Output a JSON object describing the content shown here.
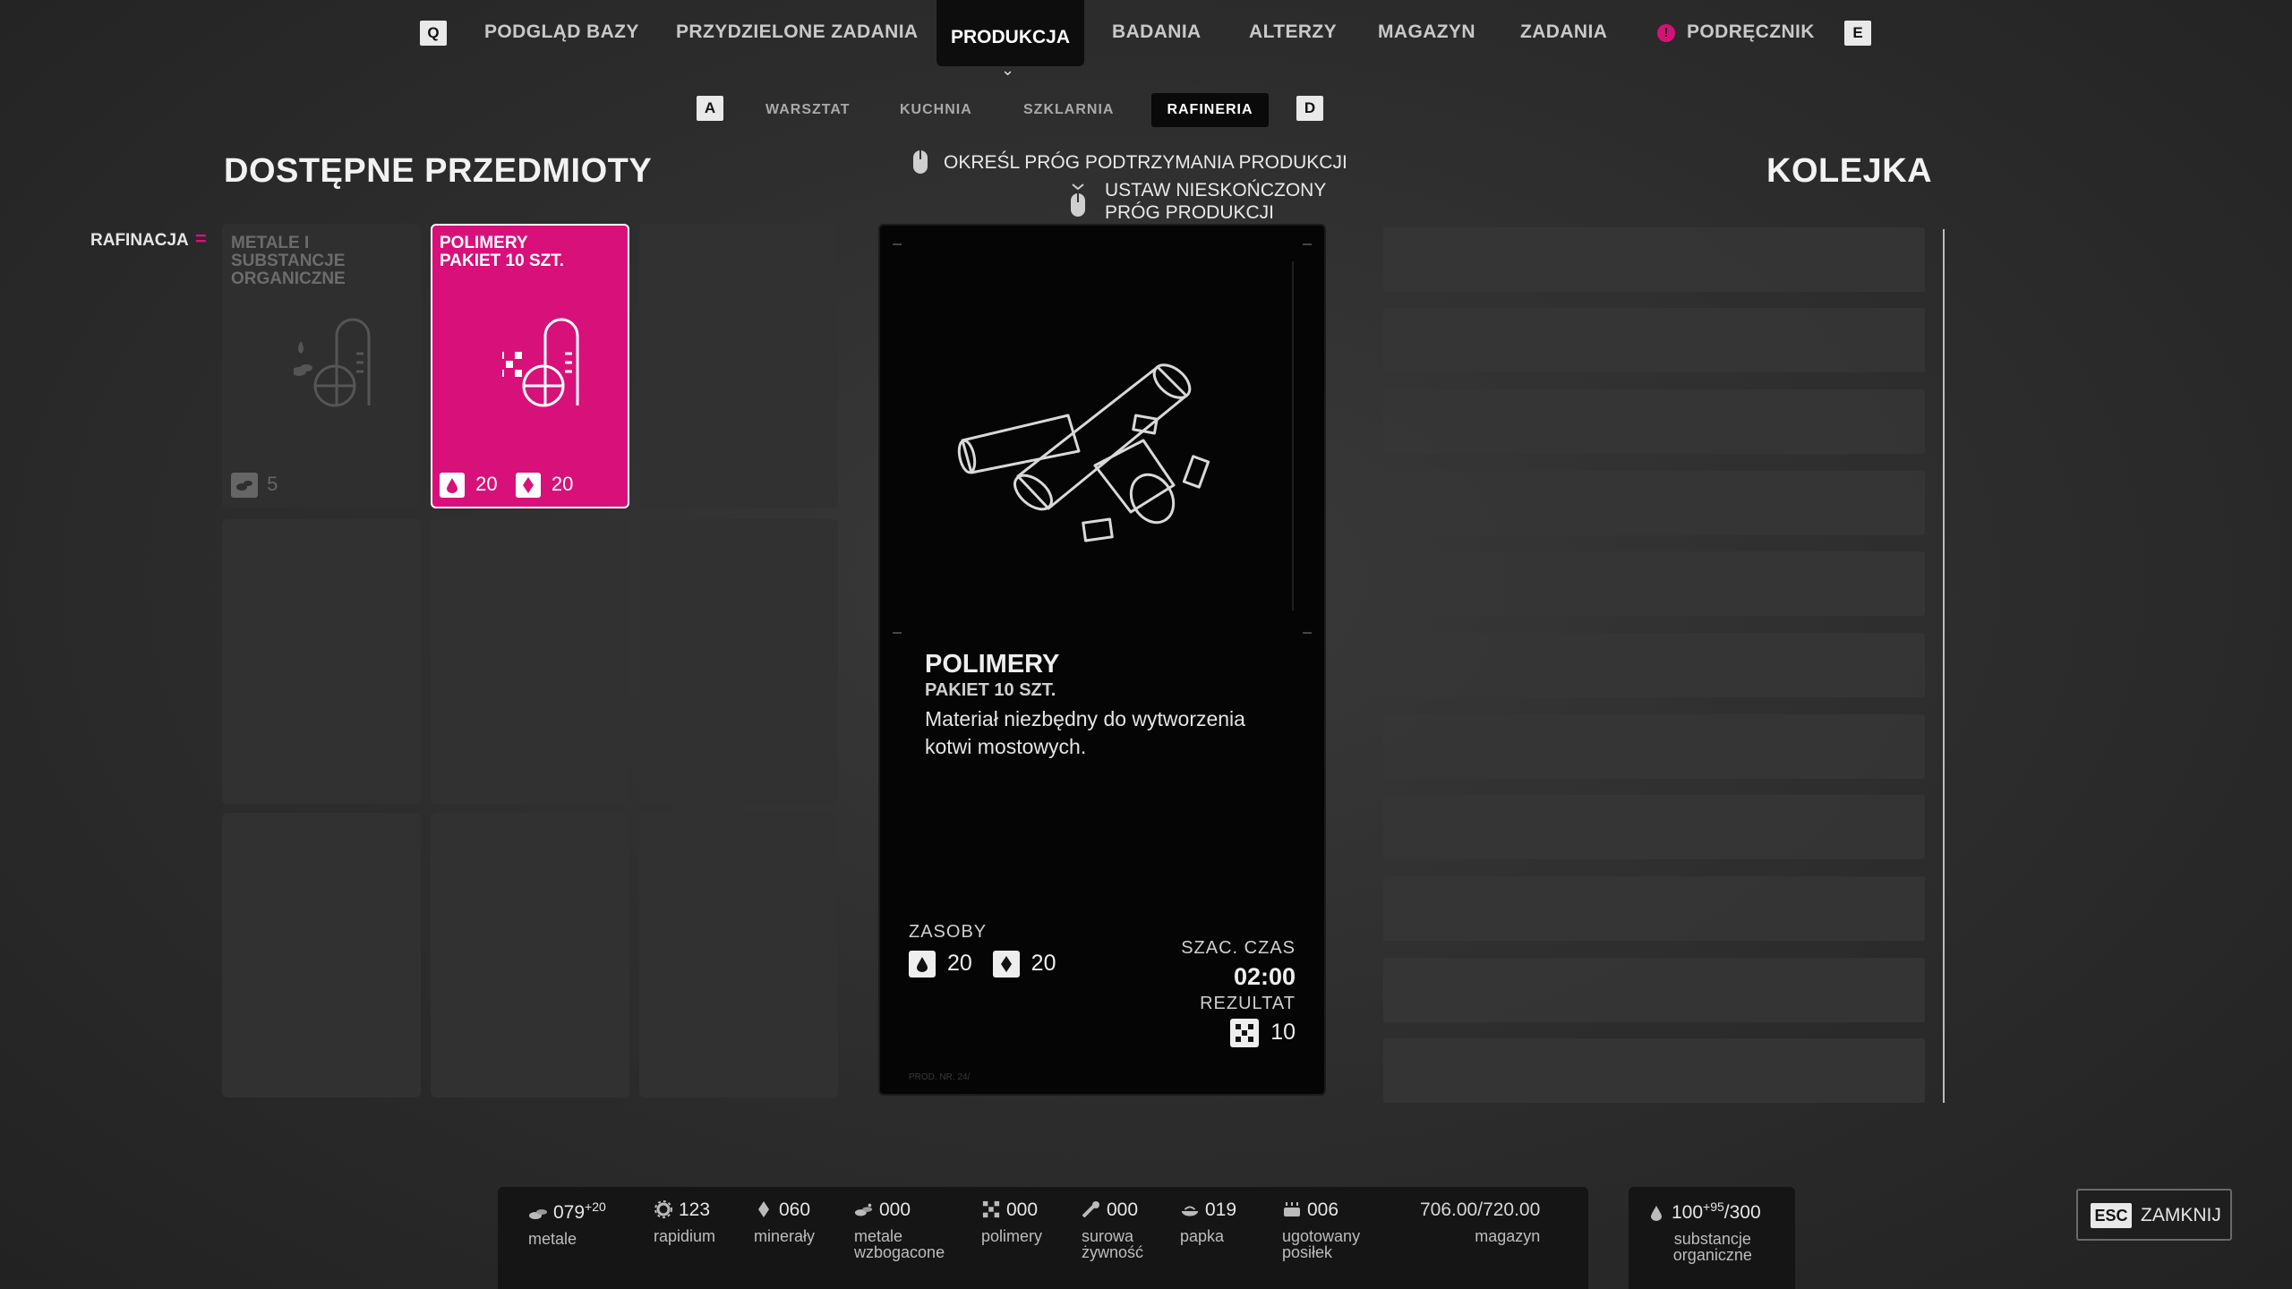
{
  "nav": {
    "left_key": "Q",
    "right_key": "E",
    "items": [
      "PODGLĄD BAZY",
      "PRZYDZIELONE ZADANIA",
      "PRODUKCJA",
      "BADANIA",
      "ALTERZY",
      "MAGAZYN",
      "ZADANIA",
      "PODRĘCZNIK"
    ],
    "chevron": "⌄"
  },
  "subnav": {
    "left_key": "A",
    "right_key": "D",
    "items": [
      "WARSZTAT",
      "KUCHNIA",
      "SZKLARNIA",
      "RAFINERIA"
    ]
  },
  "left": {
    "title": "DOSTĘPNE PRZEDMIOTY",
    "filter_label": "RAFINACJA"
  },
  "hints": {
    "hint1": "OKREŚL PRÓG PODTRZYMANIA PRODUKCJI",
    "hint2_line1": "USTAW NIESKOŃCZONY",
    "hint2_line2": "PRÓG PRODUKCJI"
  },
  "items": [
    {
      "title_line1": "METALE I",
      "title_line2": "SUBSTANCJE",
      "title_line3": "ORGANICZNE",
      "cost": "5",
      "locked": true
    },
    {
      "title_line1": "POLIMERY",
      "title_line2": "PAKIET 10 SZT.",
      "cost1": "20",
      "cost2": "20",
      "selected": true
    }
  ],
  "detail": {
    "name": "POLIMERY",
    "sub": "PAKIET 10 SZT.",
    "desc_line1": "Materiał niezbędny do wytworzenia",
    "desc_line2": "kotwi mostowych.",
    "resources_label": "ZASOBY",
    "res1": "20",
    "res2": "20",
    "time_label": "SZAC. CZAS",
    "time": "02:00",
    "result_label": "REZULTAT",
    "result": "10",
    "watermark": "PROD. NR. 24/"
  },
  "queue": {
    "title": "KOLEJKA"
  },
  "resources": [
    {
      "icon": "metal-icon",
      "value": "079",
      "delta": "+20",
      "label": "metale"
    },
    {
      "icon": "rapidium-icon",
      "value": "123",
      "label": "rapidium"
    },
    {
      "icon": "mineral-icon",
      "value": "060",
      "label": "minerały"
    },
    {
      "icon": "enriched-metal-icon",
      "value": "000",
      "label": "metale",
      "label2": "wzbogacone"
    },
    {
      "icon": "polymer-icon",
      "value": "000",
      "label": "polimery"
    },
    {
      "icon": "raw-food-icon",
      "value": "000",
      "label": "surowa",
      "label2": "żywność"
    },
    {
      "icon": "mush-icon",
      "value": "019",
      "label": "papka"
    },
    {
      "icon": "meal-icon",
      "value": "006",
      "label": "ugotowany",
      "label2": "posiłek"
    }
  ],
  "storage": {
    "value": "706.00/720.00",
    "label": "magazyn"
  },
  "organic": {
    "value": "100",
    "delta": "+95",
    "max": "/300",
    "label": "substancje",
    "label2": "organiczne"
  },
  "close": {
    "key": "ESC",
    "label": "ZAMKNIJ"
  },
  "colors": {
    "accent": "#d8117a",
    "panel": "#050505"
  }
}
